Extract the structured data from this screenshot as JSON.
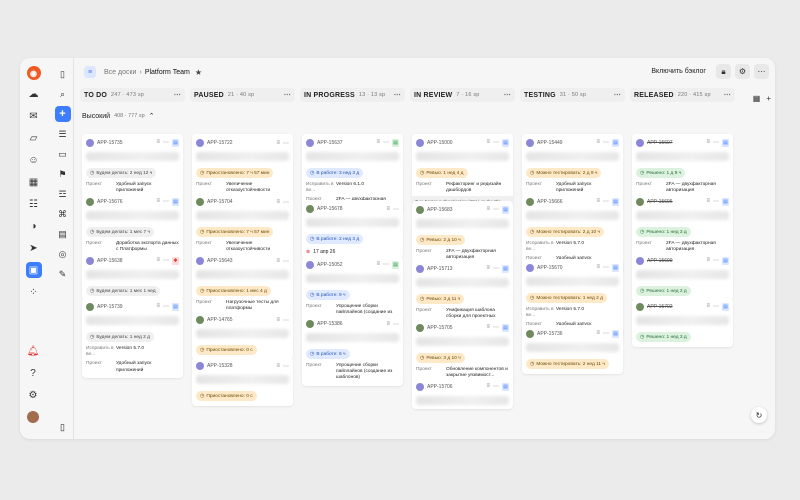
{
  "rail": {
    "icons": [
      "logo-icon",
      "home-icon",
      "mail-icon",
      "cloud-icon",
      "chat-icon",
      "calendar-icon",
      "tasks-icon",
      "bell-icon",
      "telegram-icon",
      "boards-icon",
      "apps-icon"
    ],
    "bottom": [
      "bell-icon",
      "help-icon",
      "settings-icon",
      "avatar"
    ]
  },
  "header": {
    "crumb_root": "Все доски",
    "sep": "›",
    "board_name": "Platform Team",
    "backlog_btn": "Включить бэклог"
  },
  "group": {
    "label": "Высокий",
    "count": "408 · 777 sp"
  },
  "columns": [
    {
      "title": "TO DO",
      "count": "247 · 473 sp"
    },
    {
      "title": "PAUSED",
      "count": "21 · 40 sp"
    },
    {
      "title": "IN PROGRESS",
      "count": "13 · 13 sp"
    },
    {
      "title": "IN REVIEW",
      "count": "7 · 16 sp"
    },
    {
      "title": "TESTING",
      "count": "31 · 50 sp"
    },
    {
      "title": "RELEASED",
      "count": "220 · 415 sp"
    }
  ],
  "cards": [
    [
      {
        "key": "APP-15735",
        "type": "doc",
        "pill": {
          "tone": "gray",
          "text": "Будем делать: 2 нед 12 ч"
        },
        "rows": [
          [
            "Проект",
            "Удобный запуск приложений"
          ]
        ]
      },
      {
        "key": "APP-15676",
        "type": "doc",
        "pill": {
          "tone": "gray",
          "text": "Будем делать: 1 мес 7 ч"
        },
        "rows": [
          [
            "Проект",
            "Доработка экспорта данных с Платформы"
          ]
        ]
      },
      {
        "key": "APP-15638",
        "type": "bug",
        "pill": {
          "tone": "gray",
          "text": "Будем делать: 1 мес 1 нед"
        },
        "rows": []
      },
      {
        "key": "APP-15739",
        "type": "doc",
        "pill": {
          "tone": "gray",
          "text": "Будем делать: 1 нед 2 д"
        },
        "rows": [
          [
            "Исправить в ве...",
            "Version 5.7.0"
          ],
          [
            "Проект",
            "Удобный запуск приложений"
          ]
        ]
      }
    ],
    [
      {
        "key": "APP-15722",
        "type": "",
        "pill": {
          "tone": "orange",
          "text": "Приостановлено: 7 ч 57 мин"
        },
        "rows": [
          [
            "Проект",
            "Увеличение отказоустойчивости"
          ]
        ]
      },
      {
        "key": "APP-15704",
        "type": "",
        "pill": {
          "tone": "orange",
          "text": "Приостановлено: 7 ч 57 мин"
        },
        "rows": [
          [
            "Проект",
            "Увеличение отказоустойчивости"
          ]
        ]
      },
      {
        "key": "APP-15643",
        "type": "",
        "pill": {
          "tone": "orange",
          "text": "Приостановлено: 1 мес 4 д"
        },
        "rows": [
          [
            "Проект",
            "Нагрузочные тесты для платформы"
          ]
        ]
      },
      {
        "key": "APP-14765",
        "type": "",
        "pill": {
          "tone": "orange",
          "text": "Приостановлено: 0 с"
        },
        "rows": []
      },
      {
        "key": "APP-15328",
        "type": "",
        "pill": {
          "tone": "orange",
          "text": "Приостановлено: 0 с"
        },
        "rows": []
      }
    ],
    [
      {
        "key": "APP-15637",
        "type": "gr",
        "pill": {
          "tone": "blue",
          "text": "В работе: 3 нед 3 д"
        },
        "rows": [
          [
            "Исправить в ве...",
            "Version 6.1.0"
          ],
          [
            "Проект",
            "2FA — двухфакторная авторизация"
          ]
        ]
      },
      {
        "key": "APP-15678",
        "type": "",
        "pill": {
          "tone": "blue",
          "text": "В работе: 2 нед 3 д"
        },
        "note": "17 апр 26",
        "rows": []
      },
      {
        "key": "APP-15052",
        "type": "gr",
        "pill": {
          "tone": "blue",
          "text": "В работе: 9 ч"
        },
        "rows": [
          [
            "Проект",
            "Упрощение сборки пайплайнов (создание из шаблонов)"
          ]
        ]
      },
      {
        "key": "APP-15386",
        "type": "",
        "pill": {
          "tone": "blue",
          "text": "В работе: 6 ч"
        },
        "rows": [
          [
            "Проект",
            "Упрощение сборки пайплайнов (создание из шаблонов)"
          ]
        ]
      }
    ],
    [
      {
        "key": "APP-15000",
        "type": "doc",
        "pill": {
          "tone": "orange",
          "text": "Ревью: 1 нед 4 д"
        },
        "rows": [
          [
            "Проект",
            "Рефакторинг и редизайн дашбордов"
          ]
        ],
        "stripe": "Two-Factor Authentication (2FA) on the Pla..."
      },
      {
        "key": "APP-15683",
        "type": "doc",
        "pill": {
          "tone": "orange",
          "text": "Ревью: 2 д 10 ч"
        },
        "rows": [
          [
            "Проект",
            "2FA — двухфакторная авторизация"
          ]
        ]
      },
      {
        "key": "APP-15713",
        "type": "doc",
        "pill": {
          "tone": "orange",
          "text": "Ревью: 3 д 11 ч"
        },
        "rows": [
          [
            "Проект",
            "Унификация шаблона сборки для проектных команд"
          ]
        ]
      },
      {
        "key": "APP-15705",
        "type": "doc",
        "pill": {
          "tone": "orange",
          "text": "Ревью: 3 д 10 ч"
        },
        "rows": [
          [
            "Проект",
            "Обновление компонентов и закрытие уязвимост..."
          ]
        ]
      },
      {
        "key": "APP-15706",
        "type": "doc",
        "pill": null,
        "rows": []
      }
    ],
    [
      {
        "key": "APP-15449",
        "type": "doc",
        "pill": {
          "tone": "orange",
          "text": "Можно тестировать: 2 д 9 ч"
        },
        "rows": [
          [
            "Проект",
            "Удобный запуск приложений"
          ]
        ]
      },
      {
        "key": "APP-15666",
        "type": "doc",
        "pill": {
          "tone": "orange",
          "text": "Можно тестировать: 2 д 10 ч"
        },
        "rows": [
          [
            "Исправить в ве...",
            "Version 5.7.0"
          ],
          [
            "Проект",
            "Удобный запуск приложений"
          ]
        ]
      },
      {
        "key": "APP-15670",
        "type": "doc",
        "pill": {
          "tone": "orange",
          "text": "Можно тестировать: 1 нед 2 д"
        },
        "rows": [
          [
            "Исправить в ве...",
            "Version 5.7.0"
          ],
          [
            "Проект",
            "Удобный запуск приложений"
          ]
        ]
      },
      {
        "key": "APP-15736",
        "type": "doc",
        "pill": {
          "tone": "orange",
          "text": "Можно тестировать: 2 нед 11 ч"
        },
        "rows": []
      }
    ],
    [
      {
        "key": "APP-15697",
        "type": "doc",
        "done": true,
        "pill": {
          "tone": "green",
          "text": "Решено: 1 д 9 ч"
        },
        "rows": [
          [
            "Проект",
            "2FA — двухфакторная авторизация"
          ]
        ]
      },
      {
        "key": "APP-15696",
        "type": "doc",
        "done": true,
        "pill": {
          "tone": "green",
          "text": "Решено: 1 нед 3 д"
        },
        "rows": [
          [
            "Проект",
            "2FA — двухфакторная авторизация"
          ]
        ]
      },
      {
        "key": "APP-15699",
        "type": "doc",
        "done": true,
        "pill": {
          "tone": "green",
          "text": "Решено: 1 нед 3 д"
        },
        "rows": []
      },
      {
        "key": "APP-15702",
        "type": "doc",
        "done": true,
        "pill": {
          "tone": "green",
          "text": "Решено: 1 нед 3 д"
        },
        "rows": []
      }
    ]
  ]
}
